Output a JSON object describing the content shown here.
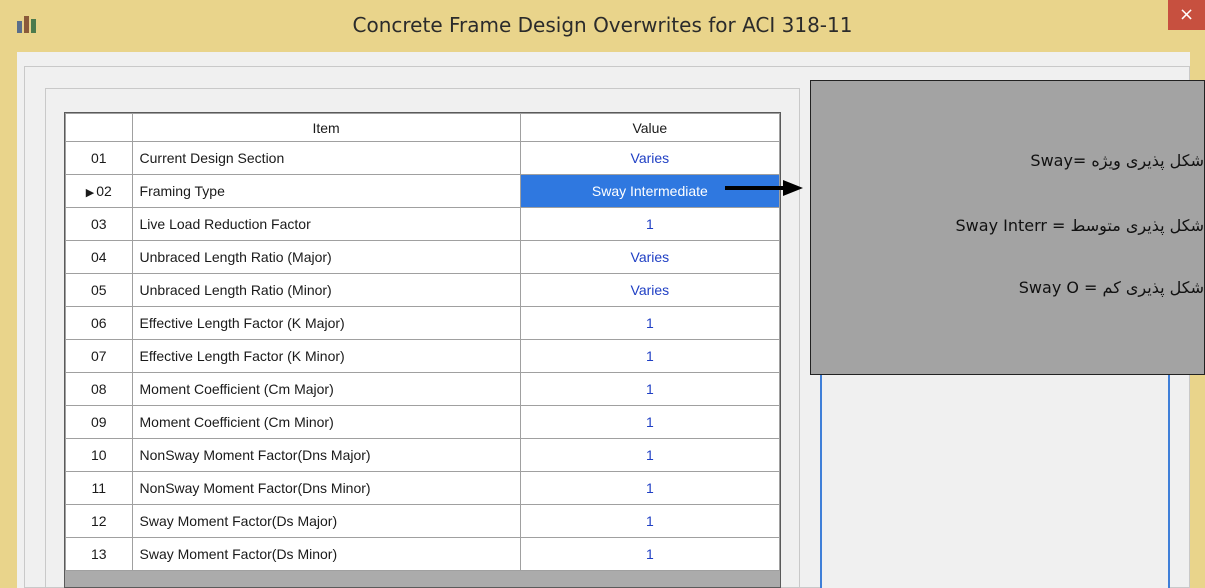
{
  "window": {
    "title": "Concrete Frame Design Overwrites for ACI 318-11",
    "close_label": "×"
  },
  "grid": {
    "headers": {
      "num": "",
      "item": "Item",
      "value": "Value"
    },
    "selected_marker": "▶",
    "rows": [
      {
        "num": "01",
        "item": "Current Design Section",
        "value": "Varies"
      },
      {
        "num": "02",
        "item": "Framing Type",
        "value": "Sway Intermediate"
      },
      {
        "num": "03",
        "item": "Live Load Reduction Factor",
        "value": "1"
      },
      {
        "num": "04",
        "item": "Unbraced Length Ratio (Major)",
        "value": "Varies"
      },
      {
        "num": "05",
        "item": "Unbraced Length Ratio (Minor)",
        "value": "Varies"
      },
      {
        "num": "06",
        "item": "Effective Length Factor (K Major)",
        "value": "1"
      },
      {
        "num": "07",
        "item": "Effective Length Factor (K Minor)",
        "value": "1"
      },
      {
        "num": "08",
        "item": "Moment Coefficient (Cm Major)",
        "value": "1"
      },
      {
        "num": "09",
        "item": "Moment Coefficient (Cm Minor)",
        "value": "1"
      },
      {
        "num": "10",
        "item": "NonSway Moment Factor(Dns Major)",
        "value": "1"
      },
      {
        "num": "11",
        "item": "NonSway Moment Factor(Dns Minor)",
        "value": "1"
      },
      {
        "num": "12",
        "item": "Sway Moment Factor(Ds Major)",
        "value": "1"
      },
      {
        "num": "13",
        "item": "Sway Moment Factor(Ds Minor)",
        "value": "1"
      }
    ]
  },
  "annotation": {
    "lines": [
      "Sway= شکل پذیری ویژه",
      "Sway Interr = شکل پذیری  متوسط",
      "Sway O = شکل پذیری کم"
    ]
  },
  "colors": {
    "frame": "#e9d48b",
    "close": "#c7503f",
    "value_text": "#1f3fc4",
    "selection": "#2f78e0",
    "callout": "#a3a3a3"
  }
}
